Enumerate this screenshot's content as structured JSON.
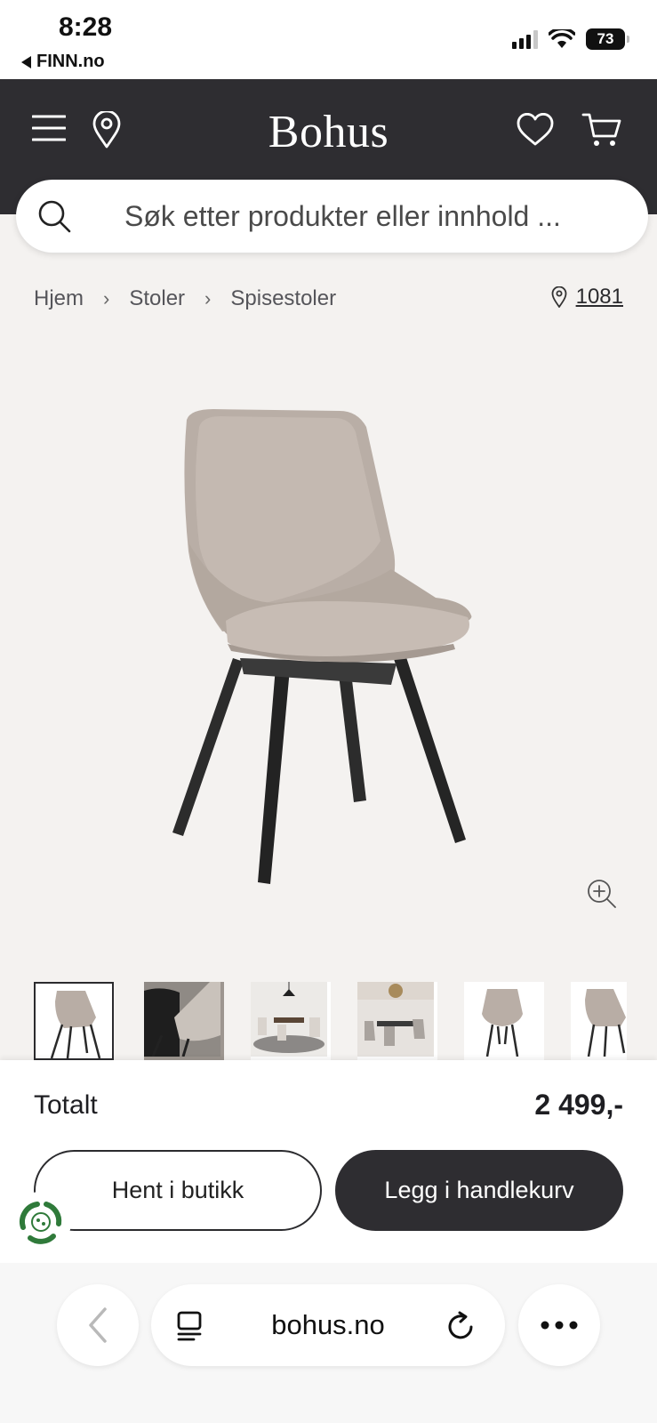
{
  "status_bar": {
    "time": "8:28",
    "back_app": "FINN.no",
    "battery": "73"
  },
  "header": {
    "logo": "Bohus"
  },
  "search": {
    "placeholder": "Søk etter produkter eller innhold ..."
  },
  "breadcrumb": [
    "Hjem",
    "Stoler",
    "Spisestoler"
  ],
  "location": {
    "postcode": "1081"
  },
  "product": {
    "thumbnail_count": 6,
    "active_thumbnail": 1
  },
  "purchase": {
    "total_label": "Totalt",
    "total_price": "2 499,-",
    "pickup_label": "Hent i butikk",
    "cart_label": "Legg i handlekurv"
  },
  "browser": {
    "url": "bohus.no"
  },
  "colors": {
    "header_bg": "#2e2d31",
    "page_bg": "#f4f2f0",
    "eco_green": "#2f7a3a"
  },
  "icons": [
    "menu-icon",
    "location-pin-icon",
    "heart-icon",
    "cart-icon",
    "search-icon",
    "zoom-icon",
    "back-icon",
    "tabs-icon",
    "reload-icon",
    "more-icon"
  ]
}
